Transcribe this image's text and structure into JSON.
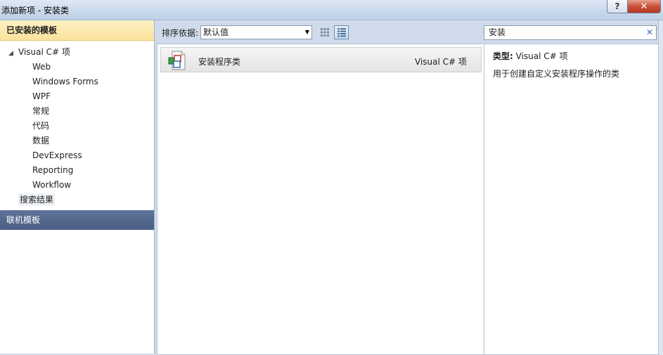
{
  "window": {
    "title": "添加新项 - 安装类",
    "help_label": "?",
    "close_label": "✕"
  },
  "sidebar": {
    "installed_header": "已安装的模板",
    "root": {
      "label": "Visual C# 项",
      "arrow": "◢"
    },
    "children": [
      "Web",
      "Windows Forms",
      "WPF",
      "常规",
      "代码",
      "数据",
      "DevExpress",
      "Reporting",
      "Workflow"
    ],
    "search_results": "搜索结果",
    "online_header": "联机模板"
  },
  "toolbar": {
    "sort_label": "排序依据:",
    "sort_value": "默认值",
    "search_value": "安装",
    "search_clear": "✕"
  },
  "list": {
    "items": [
      {
        "name": "安装程序类",
        "type": "Visual C# 项",
        "icon": "installer-class-icon"
      }
    ]
  },
  "details": {
    "type_label": "类型:",
    "type_value": "Visual C# 项",
    "description": "用于创建自定义安装程序操作的类"
  },
  "colors": {
    "installed_header": "#fbe29a",
    "online_header": "#4b5e84",
    "frame": "#cfdbea"
  }
}
